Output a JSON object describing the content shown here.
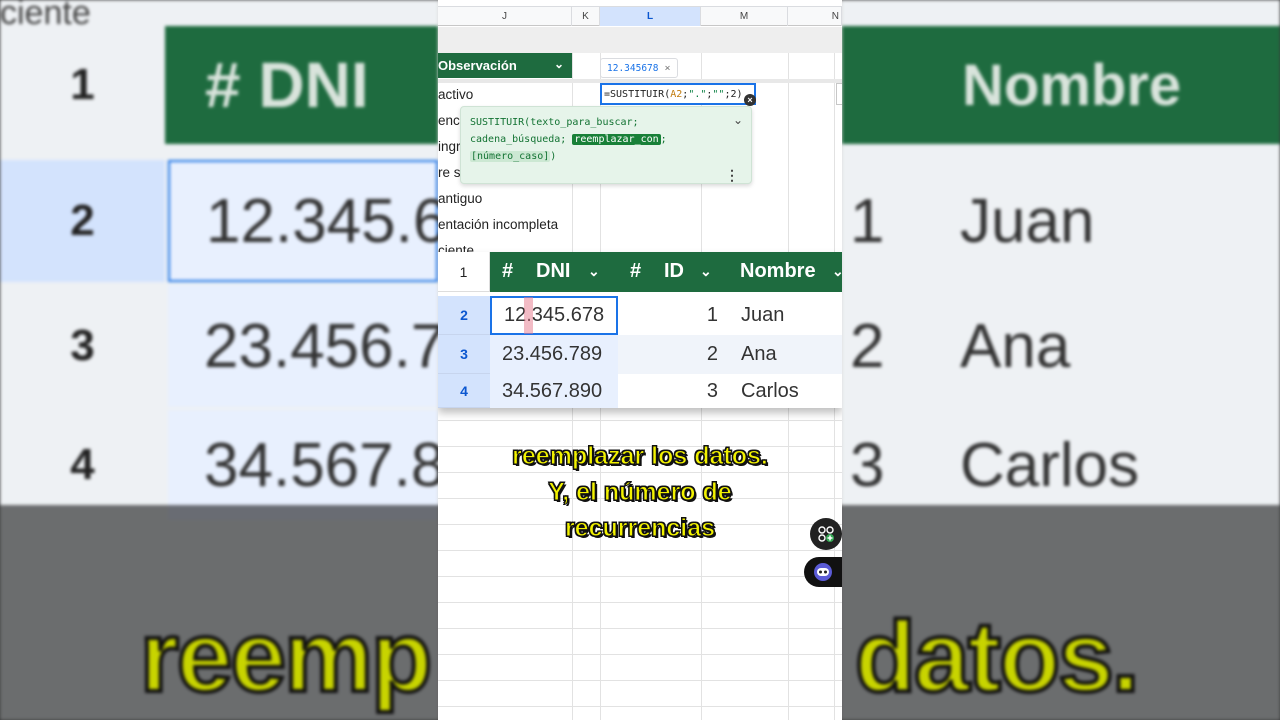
{
  "background": {
    "top_word": "ciente",
    "header_left": "#   DNI",
    "header_right": "Nombre",
    "rows": [
      {
        "num": "1",
        "dni": "",
        "id": "",
        "name": ""
      },
      {
        "num": "2",
        "dni": "12.345.6",
        "id": "1",
        "name": "Juan"
      },
      {
        "num": "3",
        "dni": "23.456.7",
        "id": "2",
        "name": "Ana"
      },
      {
        "num": "4",
        "dni": "34.567.8",
        "id": "3",
        "name": "Carlos"
      }
    ],
    "caption_left": "reemp",
    "caption_right": "datos."
  },
  "sheet": {
    "columns": [
      "J",
      "K",
      "L",
      "M",
      "N"
    ],
    "observacion_header": "Observación",
    "observacion_cells": [
      "activo",
      "enci",
      "ingr",
      "re s",
      "antiguo",
      "entación incompleta",
      "ciente"
    ],
    "name_box_value": "12.345678",
    "name_box_close": "×",
    "formula": {
      "prefix": "=SUSTITUIR(",
      "ref": "A2",
      "sep1": ";",
      "str1": "\".\"",
      "sep2": ";",
      "str2": "\"\"",
      "sep3": ";",
      "tail": " 2)"
    },
    "tooltip": {
      "line1": "SUSTITUIR(texto_para_buscar;",
      "line2_a": "cadena_búsqueda; ",
      "line2_hl": "reemplazar_con",
      "line2_b": ";",
      "line3_opt": "[número_caso]",
      "line3_b": ")",
      "more": "⋮"
    }
  },
  "zoom_table": {
    "corner": "1",
    "headers": [
      "#",
      "DNI",
      "#",
      "ID",
      "Nombre"
    ],
    "rows": [
      {
        "num": "2",
        "dni": "12.345.678",
        "id": "1",
        "name": "Juan"
      },
      {
        "num": "3",
        "dni": "23.456.789",
        "id": "2",
        "name": "Ana"
      },
      {
        "num": "4",
        "dni": "34.567.890",
        "id": "3",
        "name": "Carlos"
      }
    ]
  },
  "caption": {
    "line1": "reemplazar los datos.",
    "line2": "Y, el número de",
    "line3": "recurrencias"
  },
  "colors": {
    "header_green": "#1e6b3f",
    "selection_blue": "#1a73e8",
    "caption_yellow": "#f2f200"
  },
  "icons": {
    "fab_top": "add-shape-icon",
    "fab_bottom": "assistant-face-icon"
  }
}
